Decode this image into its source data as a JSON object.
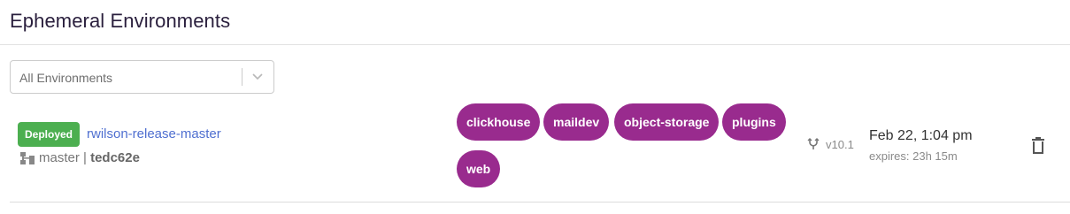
{
  "header": {
    "title": "Ephemeral Environments"
  },
  "filter": {
    "selected": "All Environments",
    "chevron_icon": "chevron-down-icon"
  },
  "environments": [
    {
      "status": "Deployed",
      "status_color": "#4caf50",
      "name": "rwilson-release-master",
      "branch": "master",
      "separator": "|",
      "commit": "tedc62e",
      "branch_icon": "branch-tree-icon",
      "tags": [
        "clickhouse",
        "maildev",
        "object-storage",
        "plugins",
        "web"
      ],
      "tag_color": "#992b8e",
      "version_icon": "git-merge-icon",
      "version": "v10.1",
      "created": "Feb 22, 1:04 pm",
      "expires": "expires: 23h 15m",
      "delete_icon": "trash-icon"
    }
  ]
}
